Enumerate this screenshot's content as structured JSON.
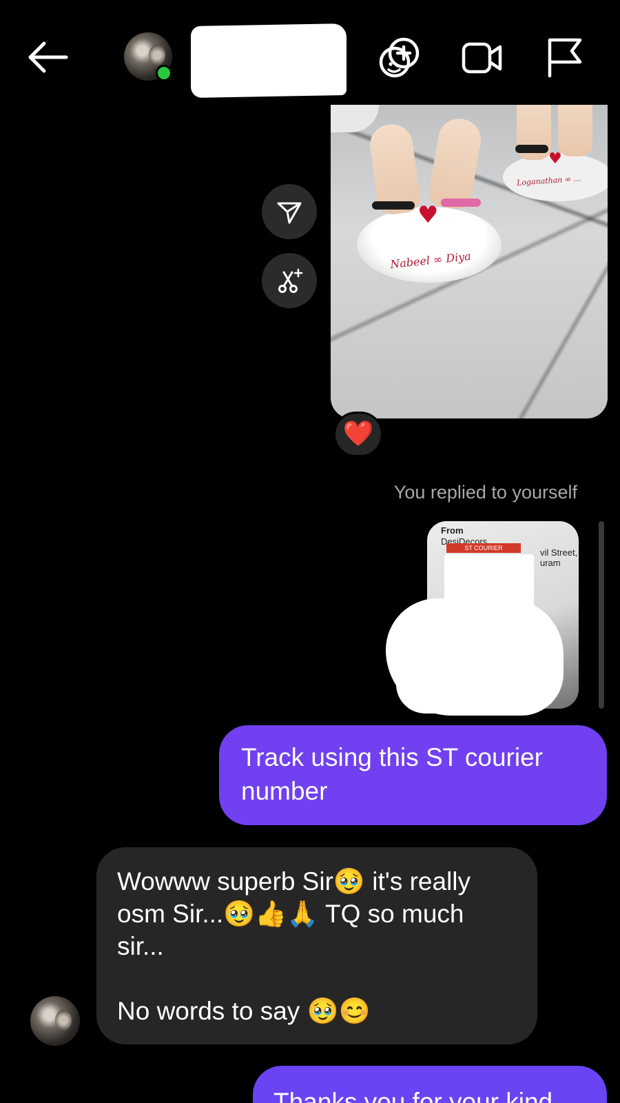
{
  "header": {
    "back_icon": "arrow-left-icon",
    "avatar_status": "online",
    "actions": [
      {
        "name": "add-effect-icon"
      },
      {
        "name": "video-call-icon"
      },
      {
        "name": "flag-icon"
      }
    ],
    "online_color": "#28c83c"
  },
  "photo_message": {
    "stand_names": "Nabeel ∞ Diya",
    "stand_names_2": "Loganathan ∞ ..."
  },
  "side_actions": [
    {
      "name": "share-icon"
    },
    {
      "name": "ai-edit-icon"
    }
  ],
  "reaction": {
    "emoji": "❤️"
  },
  "reply_note": "You replied to yourself",
  "courier_image": {
    "from_label": "From",
    "company": "DesiDecors",
    "label_text": "ST COURIER",
    "address_fragment": "vil Street,\nuram"
  },
  "messages": {
    "outgoing_1": "Track using this ST courier number",
    "incoming_1": "Wowww superb Sir🥹 it's really osm Sir...🥹👍🙏 TQ so much sir...\n\nNo words to say 🥹😊",
    "outgoing_2": "Thanks you for your kind"
  },
  "colors": {
    "outgoing_bubble": "#7140f0",
    "incoming_bubble": "#262626",
    "background": "#000000"
  }
}
